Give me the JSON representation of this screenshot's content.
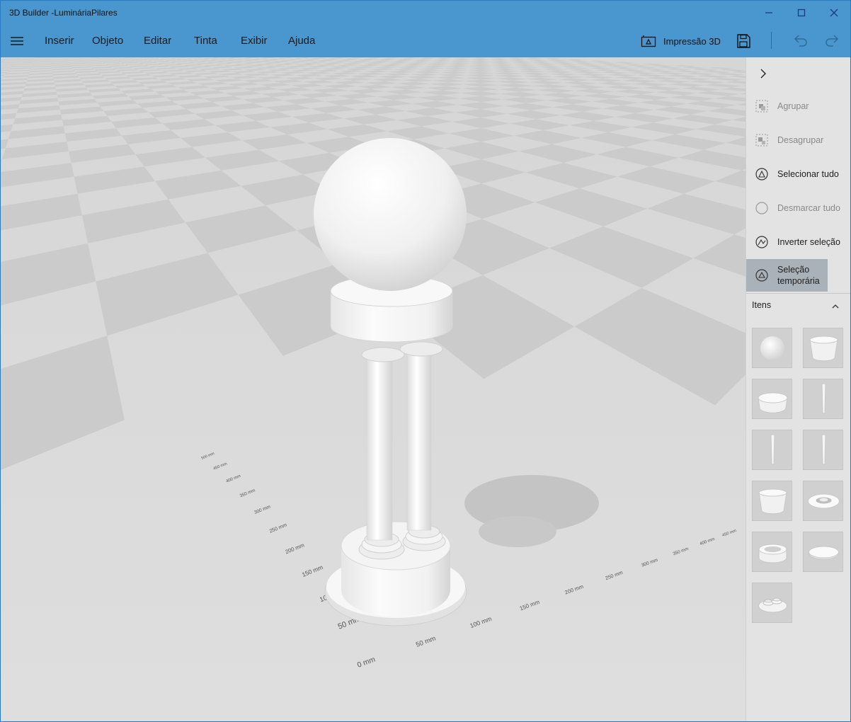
{
  "window": {
    "title": "3D Builder -LumináriaPilares",
    "accent": "#4a97cf"
  },
  "menu": {
    "items": [
      "Inserir",
      "Objeto",
      "Editar",
      "Tinta",
      "Exibir",
      "Ajuda"
    ],
    "print_label": "Impressão 3D"
  },
  "viewport": {
    "ruler_left": [
      "50 mm",
      "100 mm",
      "150 mm",
      "200 mm",
      "250 mm",
      "300 mm",
      "350 mm",
      "400 mm",
      "450 mm",
      "500 mm"
    ],
    "ruler_right": [
      "0 mm",
      "50 mm",
      "100 mm",
      "150 mm",
      "200 mm",
      "250 mm",
      "300 mm",
      "350 mm",
      "400 mm",
      "450 mm"
    ]
  },
  "panel": {
    "commands": [
      {
        "label": "Agrupar",
        "enabled": false
      },
      {
        "label": "Desagrupar",
        "enabled": false
      },
      {
        "label": "Selecionar tudo",
        "enabled": true
      },
      {
        "label": "Desmarcar tudo",
        "enabled": false
      },
      {
        "label": "Inverter seleção",
        "enabled": true
      },
      {
        "label": "Seleção temporária",
        "enabled": true,
        "active": true
      }
    ],
    "items_header": "Itens",
    "items": [
      "sphere",
      "bowl",
      "ring-cylinder",
      "pillar",
      "pillar",
      "pillar",
      "bowl",
      "ring-disc",
      "ring",
      "flat-disc",
      "base-disc"
    ]
  }
}
